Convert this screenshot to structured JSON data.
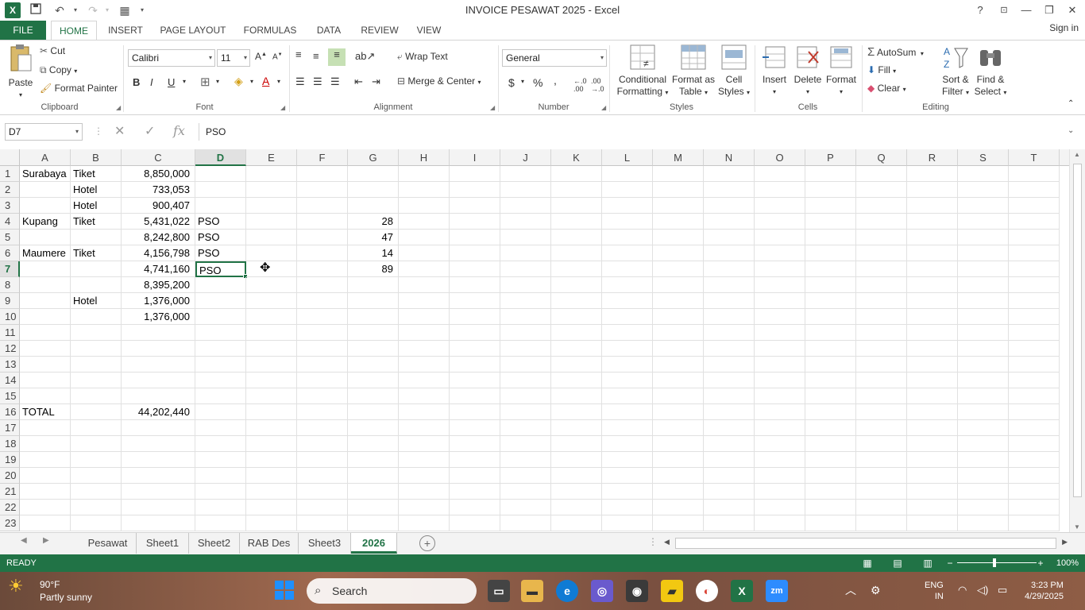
{
  "window": {
    "title": "INVOICE PESAWAT 2025 - Excel",
    "app_logo": "X",
    "help": "?",
    "minimize": "—",
    "restore": "❐",
    "close": "✕"
  },
  "ribbon_tabs": {
    "file": "FILE",
    "tabs": [
      "HOME",
      "INSERT",
      "PAGE LAYOUT",
      "FORMULAS",
      "DATA",
      "REVIEW",
      "VIEW"
    ],
    "active": "HOME",
    "signin": "Sign in"
  },
  "clipboard": {
    "paste": "Paste",
    "cut": "Cut",
    "copy": "Copy",
    "format_painter": "Format Painter",
    "label": "Clipboard"
  },
  "font": {
    "name": "Calibri",
    "size": "11",
    "bold": "B",
    "italic": "I",
    "underline": "U",
    "label": "Font"
  },
  "alignment": {
    "wrap_text": "Wrap Text",
    "merge_center": "Merge & Center",
    "label": "Alignment"
  },
  "number": {
    "format": "General",
    "currency": "$",
    "percent": "%",
    "comma": ",",
    "label": "Number"
  },
  "styles": {
    "conditional_1": "Conditional",
    "conditional_2": "Formatting",
    "format_table_1": "Format as",
    "format_table_2": "Table",
    "cell_styles_1": "Cell",
    "cell_styles_2": "Styles",
    "label": "Styles"
  },
  "cells": {
    "insert": "Insert",
    "delete": "Delete",
    "format": "Format",
    "label": "Cells"
  },
  "editing": {
    "autosum": "AutoSum",
    "fill": "Fill",
    "clear": "Clear",
    "sort_1": "Sort &",
    "sort_2": "Filter",
    "find_1": "Find &",
    "find_2": "Select",
    "label": "Editing"
  },
  "formula_bar": {
    "name_box": "D7",
    "content": "PSO",
    "fx": "fx"
  },
  "grid": {
    "columns": [
      "A",
      "B",
      "C",
      "D",
      "E",
      "F",
      "G",
      "H",
      "I",
      "J",
      "K",
      "L",
      "M",
      "N",
      "O",
      "P",
      "Q",
      "R",
      "S",
      "T"
    ],
    "active_column": "D",
    "active_row": "7",
    "rows": [
      {
        "n": "1",
        "A": "Surabaya",
        "B": "Tiket",
        "C": "8,850,000",
        "D": "",
        "G": ""
      },
      {
        "n": "2",
        "A": "",
        "B": "Hotel",
        "C": "733,053",
        "D": "",
        "G": ""
      },
      {
        "n": "3",
        "A": "",
        "B": "Hotel",
        "C": "900,407",
        "D": "",
        "G": ""
      },
      {
        "n": "4",
        "A": "Kupang",
        "B": "Tiket",
        "C": "5,431,022",
        "D": "PSO",
        "G": "28"
      },
      {
        "n": "5",
        "A": "",
        "B": "",
        "C": "8,242,800",
        "D": "PSO",
        "G": "47"
      },
      {
        "n": "6",
        "A": "Maumere",
        "B": "Tiket",
        "C": "4,156,798",
        "D": "PSO",
        "G": "14"
      },
      {
        "n": "7",
        "A": "",
        "B": "",
        "C": "4,741,160",
        "D": "PSO",
        "G": "89"
      },
      {
        "n": "8",
        "A": "",
        "B": "",
        "C": "8,395,200",
        "D": "",
        "G": ""
      },
      {
        "n": "9",
        "A": "",
        "B": "Hotel",
        "C": "1,376,000",
        "D": "",
        "G": ""
      },
      {
        "n": "10",
        "A": "",
        "B": "",
        "C": "1,376,000",
        "D": "",
        "G": ""
      },
      {
        "n": "11",
        "A": "",
        "B": "",
        "C": "",
        "D": "",
        "G": ""
      },
      {
        "n": "12",
        "A": "",
        "B": "",
        "C": "",
        "D": "",
        "G": ""
      },
      {
        "n": "13",
        "A": "",
        "B": "",
        "C": "",
        "D": "",
        "G": ""
      },
      {
        "n": "14",
        "A": "",
        "B": "",
        "C": "",
        "D": "",
        "G": ""
      },
      {
        "n": "15",
        "A": "",
        "B": "",
        "C": "",
        "D": "",
        "G": ""
      },
      {
        "n": "16",
        "A": "TOTAL",
        "B": "",
        "C": "44,202,440",
        "D": "",
        "G": ""
      },
      {
        "n": "17",
        "A": "",
        "B": "",
        "C": "",
        "D": "",
        "G": ""
      },
      {
        "n": "18",
        "A": "",
        "B": "",
        "C": "",
        "D": "",
        "G": ""
      },
      {
        "n": "19",
        "A": "",
        "B": "",
        "C": "",
        "D": "",
        "G": ""
      },
      {
        "n": "20",
        "A": "",
        "B": "",
        "C": "",
        "D": "",
        "G": ""
      },
      {
        "n": "21",
        "A": "",
        "B": "",
        "C": "",
        "D": "",
        "G": ""
      },
      {
        "n": "22",
        "A": "",
        "B": "",
        "C": "",
        "D": "",
        "G": ""
      },
      {
        "n": "23",
        "A": "",
        "B": "",
        "C": "",
        "D": "",
        "G": ""
      }
    ]
  },
  "sheets": {
    "tabs": [
      "Pesawat",
      "Sheet1",
      "Sheet2",
      "RAB Des",
      "Sheet3",
      "2026"
    ],
    "active": "2026",
    "add": "+"
  },
  "status": {
    "ready": "READY",
    "zoom": "100%"
  },
  "taskbar": {
    "temp": "90°F",
    "weather": "Partly sunny",
    "search": "Search",
    "lang_1": "ENG",
    "lang_2": "IN",
    "time": "3:23 PM",
    "date": "4/29/2025"
  },
  "colors": {
    "excel_green": "#217346",
    "cursor": "#000000"
  }
}
